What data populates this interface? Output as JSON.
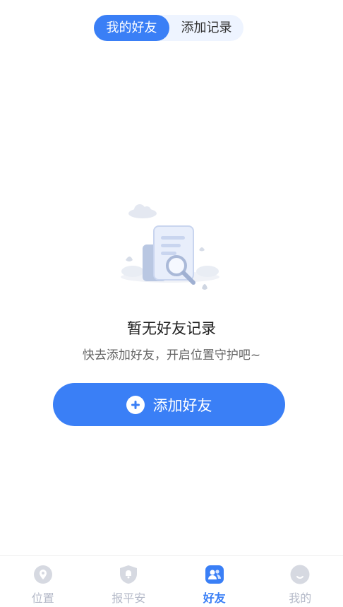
{
  "tabs": [
    {
      "label": "我的好友",
      "active": true
    },
    {
      "label": "添加记录",
      "active": false
    }
  ],
  "empty": {
    "title": "暂无好友记录",
    "subtitle": "快去添加好友，开启位置守护吧~",
    "illustration": "document-search-icon"
  },
  "add_button": {
    "label": "添加好友",
    "icon": "plus-circle-icon"
  },
  "nav": {
    "items": [
      {
        "label": "位置",
        "icon": "location-pin-icon",
        "active": false
      },
      {
        "label": "报平安",
        "icon": "shield-bell-icon",
        "active": false
      },
      {
        "label": "好友",
        "icon": "friends-icon",
        "active": true
      },
      {
        "label": "我的",
        "icon": "profile-icon",
        "active": false
      }
    ],
    "active_color": "#3a7ff6",
    "inactive_color": "#b4b9c8"
  },
  "colors": {
    "accent": "#3a7ff6",
    "tab_bg": "#eef4ff"
  }
}
